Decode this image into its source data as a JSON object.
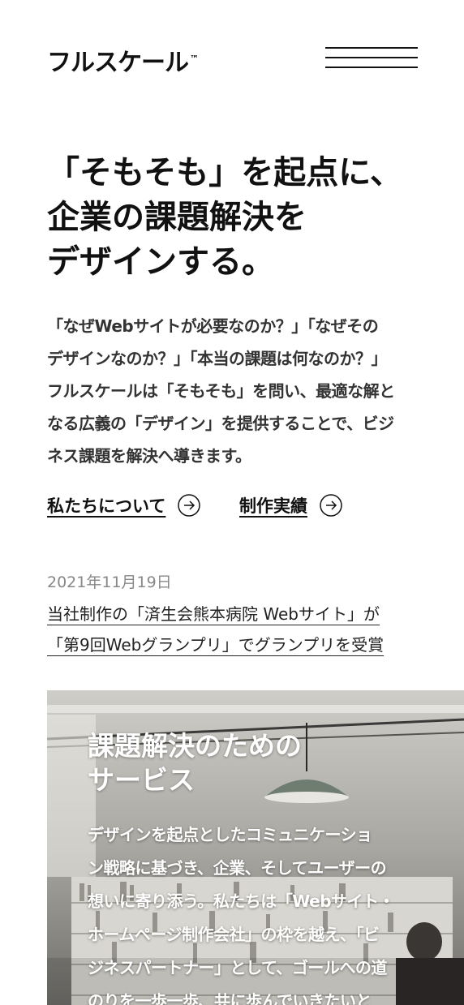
{
  "header": {
    "logo_text": "フルスケール",
    "logo_mark": "™",
    "menu_icon": "hamburger-icon"
  },
  "hero": {
    "title_lines": [
      "「そもそも」を起点に、",
      "企業の課題解決を",
      "デザインする。"
    ],
    "lead_lines": [
      "「なぜWebサイトが必要なのか？」「なぜその",
      "デザインなのか？」「本当の課題は何なのか？」",
      "フルスケールは「そもそも」を問い、最適な解と",
      "なる広義の「デザイン」を提供することで、ビジ",
      "ネス課題を解決へ導きます。"
    ]
  },
  "links": {
    "about_label": "私たちについて",
    "works_label": "制作実績",
    "arrow_icon": "circle-arrow-right-icon"
  },
  "news": {
    "date": "2021年11月19日",
    "title_lines": [
      "当社制作の「済生会熊本病院 Webサイト」が",
      "「第9回Webグランプリ」でグランプリを受賞"
    ]
  },
  "service": {
    "title_lines": [
      "課題解決のための",
      "サービス"
    ],
    "body_lines": [
      "デザインを起点としたコミュニケーショ",
      "ン戦略に基づき、企業、そしてユーザーの",
      "想いに寄り添う。私たちは「Webサイト・",
      "ホームページ制作会社」の枠を越え、「ビ",
      "ジネスパートナー」として、ゴールへの道",
      "のりを一歩一歩、共に歩んでいきたいと"
    ]
  },
  "colors": {
    "text": "#111111",
    "lead": "#333333",
    "date": "#888888",
    "background": "#ffffff"
  }
}
